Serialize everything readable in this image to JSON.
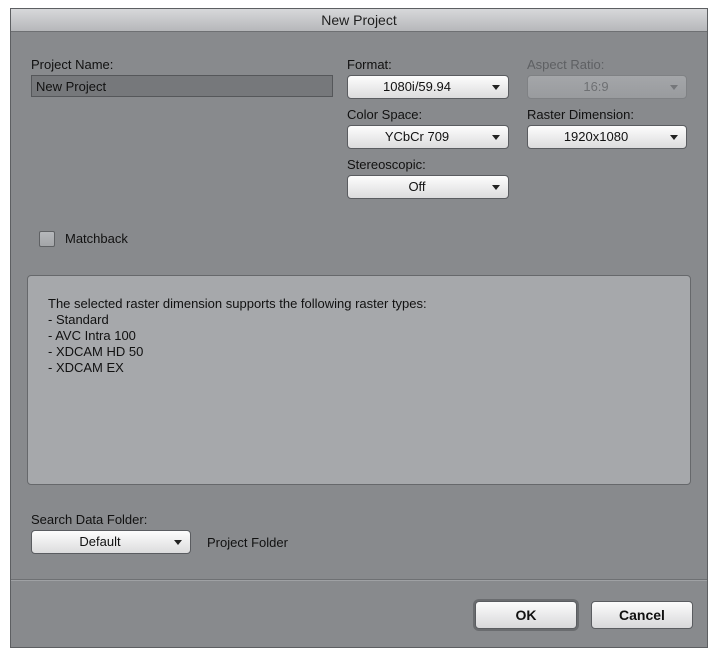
{
  "window": {
    "title": "New Project"
  },
  "project_name": {
    "label": "Project Name:",
    "value": "New Project"
  },
  "format": {
    "label": "Format:",
    "value": "1080i/59.94"
  },
  "aspect_ratio": {
    "label": "Aspect Ratio:",
    "value": "16:9",
    "enabled": false
  },
  "color_space": {
    "label": "Color Space:",
    "value": "YCbCr 709"
  },
  "raster_dimension": {
    "label": "Raster Dimension:",
    "value": "1920x1080"
  },
  "stereoscopic": {
    "label": "Stereoscopic:",
    "value": "Off"
  },
  "matchback": {
    "label": "Matchback",
    "checked": false
  },
  "info": {
    "heading": "The selected raster dimension supports the following raster types:",
    "items": [
      " - Standard",
      " - AVC Intra 100",
      " - XDCAM HD 50",
      " - XDCAM EX"
    ]
  },
  "search_data_folder": {
    "label": "Search Data Folder:",
    "value": "Default",
    "location": "Project Folder"
  },
  "buttons": {
    "ok": "OK",
    "cancel": "Cancel"
  }
}
